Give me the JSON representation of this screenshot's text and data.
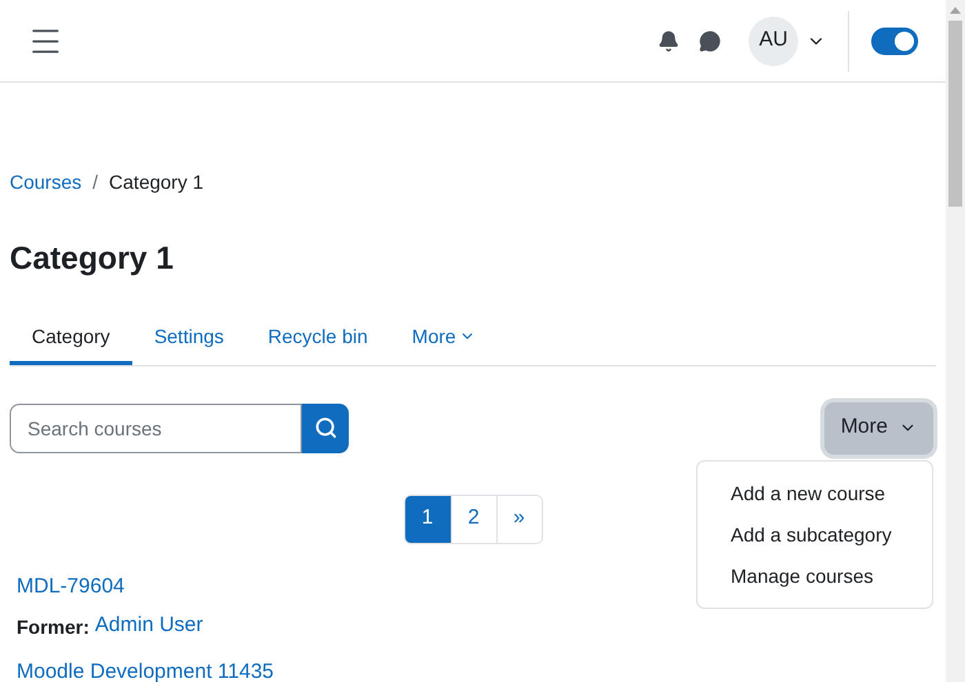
{
  "header": {
    "avatar": "AU",
    "edit_mode": {
      "on": true
    }
  },
  "breadcrumb": [
    {
      "label": "Courses",
      "kind": "link"
    },
    {
      "label": "Category 1",
      "kind": "current",
      "separator": "/"
    }
  ],
  "title": "Category 1",
  "tabs": [
    {
      "label": "Category",
      "selected": true,
      "kind": "tab"
    },
    {
      "label": "Settings",
      "selected": false,
      "kind": "tab"
    },
    {
      "label": "Recycle bin",
      "selected": false,
      "kind": "tab"
    },
    {
      "label": "More",
      "selected": false,
      "kind": "menu"
    }
  ],
  "search": {
    "placeholder": "Search courses"
  },
  "more_menu": {
    "label": "More",
    "expanded": true,
    "items": [
      "Add a new course",
      "Add a subcategory",
      "Manage courses"
    ]
  },
  "pagination": [
    {
      "label": "1",
      "selected": true
    },
    {
      "label": "2",
      "selected": false
    },
    {
      "label": "»",
      "selected": false
    }
  ],
  "courses": [
    {
      "name": "MDL-79604",
      "role": "Former:",
      "person": "Admin User"
    },
    {
      "name": "Moodle Development 11435"
    }
  ]
}
